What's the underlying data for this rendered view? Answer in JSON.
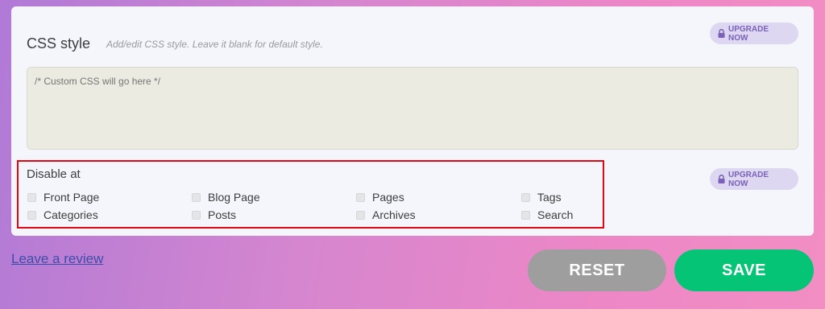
{
  "css_section": {
    "title": "CSS style",
    "hint": "Add/edit CSS style. Leave it blank for default style.",
    "upgrade_label": "UPGRADE NOW",
    "placeholder": "/* Custom CSS will go here */"
  },
  "disable_section": {
    "title": "Disable at",
    "upgrade_label": "UPGRADE NOW",
    "options": [
      {
        "label": "Front Page",
        "checked": false
      },
      {
        "label": "Blog Page",
        "checked": false
      },
      {
        "label": "Pages",
        "checked": false
      },
      {
        "label": "Tags",
        "checked": false
      },
      {
        "label": "Categories",
        "checked": false
      },
      {
        "label": "Posts",
        "checked": false
      },
      {
        "label": "Archives",
        "checked": false
      },
      {
        "label": "Search",
        "checked": false
      }
    ]
  },
  "footer": {
    "review_link": "Leave a review",
    "reset_label": "RESET",
    "save_label": "SAVE"
  },
  "colors": {
    "upgrade_bg": "#ddd7f2",
    "upgrade_text": "#7b62b8",
    "highlight_border": "#e30613",
    "reset": "#9e9e9e",
    "save": "#06c476",
    "link": "#3d4ea8"
  }
}
